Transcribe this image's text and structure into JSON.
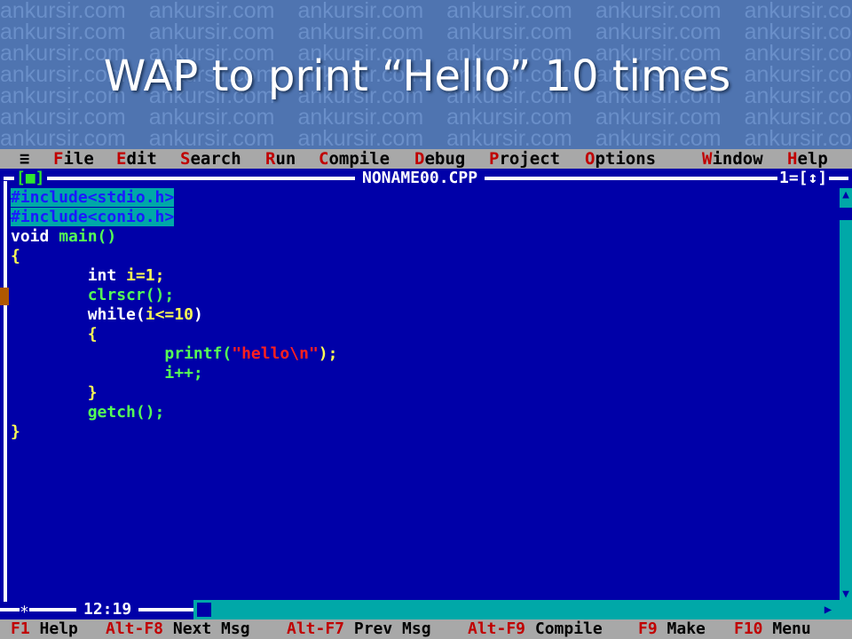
{
  "slide": {
    "watermark": "ankursir.com",
    "title": "WAP to print “Hello” 10 times"
  },
  "menubar": {
    "system_glyph": "≡",
    "items": [
      {
        "hot": "F",
        "rest": "ile"
      },
      {
        "hot": "E",
        "rest": "dit"
      },
      {
        "hot": "S",
        "rest": "earch"
      },
      {
        "hot": "R",
        "rest": "un"
      },
      {
        "hot": "C",
        "rest": "ompile"
      },
      {
        "hot": "D",
        "rest": "ebug"
      },
      {
        "hot": "P",
        "rest": "roject"
      },
      {
        "hot": "O",
        "rest": "ptions"
      },
      {
        "hot": "W",
        "rest": "indow"
      },
      {
        "hot": "H",
        "rest": "elp"
      }
    ]
  },
  "editor": {
    "close_box": "[■]",
    "filename": "NONAME00.CPP",
    "window_number": "1=[↕]",
    "cursor_position": "12:19",
    "modified_marker": "∗",
    "code": {
      "l1": "#include<stdio.h>",
      "l2": "#include<conio.h>",
      "l3_kw": "void",
      "l3_fn": "main()",
      "l4": "{",
      "l5_kw": "int",
      "l5_id": "i",
      "l5_op": "=",
      "l5_num": "1",
      "l5_end": ";",
      "l6": "clrscr();",
      "l7_kw": "while(",
      "l7_id": "i",
      "l7_op": "<=",
      "l7_num": "10",
      "l7_end": ")",
      "l8": "{",
      "l9_fn": "printf(",
      "l9_str": "\"hello\\n\"",
      "l9_end": ");",
      "l10": "i++;",
      "l11": "}",
      "l12": "getch();",
      "l13": "}"
    }
  },
  "statusbar": {
    "items": [
      {
        "key": "F1",
        "label": "Help"
      },
      {
        "key": "Alt-F8",
        "label": "Next Msg"
      },
      {
        "key": "Alt-F7",
        "label": "Prev Msg"
      },
      {
        "key": "Alt-F9",
        "label": "Compile"
      },
      {
        "key": "F9",
        "label": "Make"
      },
      {
        "key": "F10",
        "label": "Menu"
      }
    ]
  },
  "colors": {
    "editor_bg": "#0000a8",
    "menubar_bg": "#a8a8a8",
    "hotkey": "#c00000",
    "selection": "#00a8a8"
  }
}
